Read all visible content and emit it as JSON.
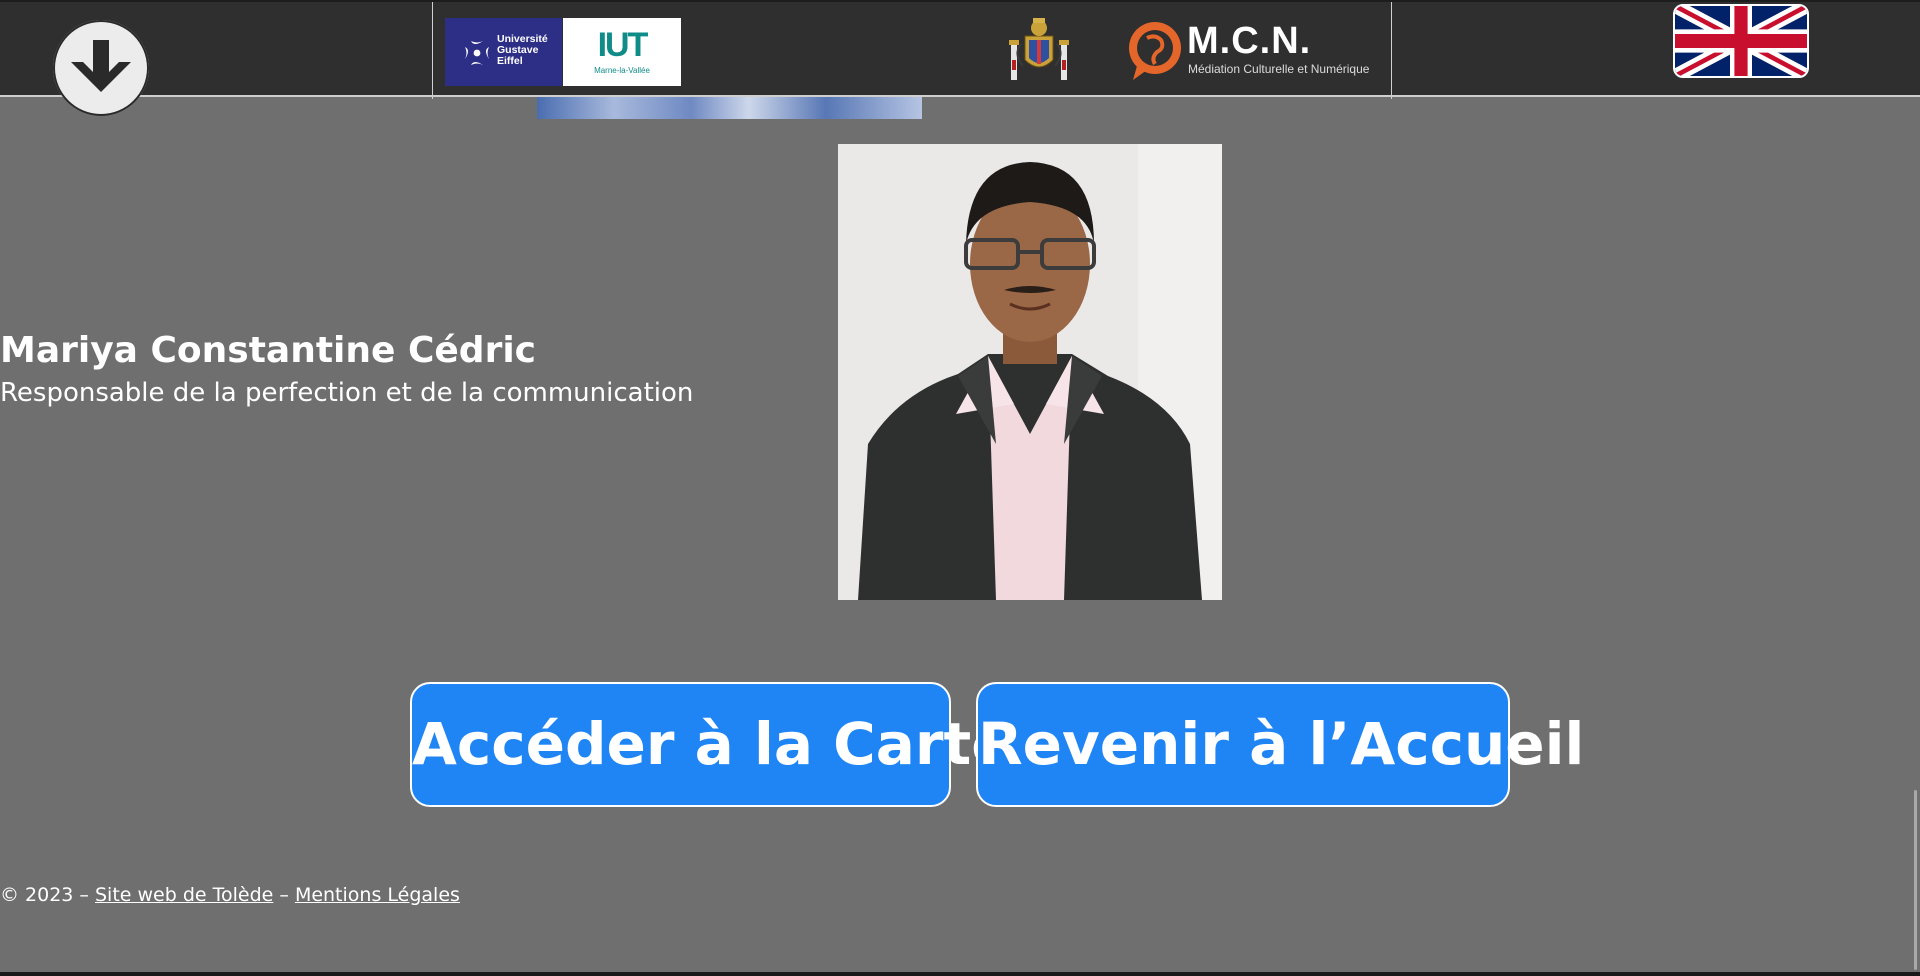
{
  "header": {
    "scroll_button_icon": "arrow-down-icon",
    "uge_logo": {
      "line1": "Université",
      "line2": "Gustave",
      "line3": "Eiffel"
    },
    "iut_logo": {
      "name": "IUT",
      "location": "Marne-la-Vallée"
    },
    "coat_of_arms_icon": "toledo-coat-of-arms-icon",
    "mcn_logo": {
      "title": "M.C.N.",
      "subtitle": "Médiation Culturelle et Numérique"
    },
    "language_flag_icon": "uk-flag-icon"
  },
  "profile": {
    "name": "Mariya Constantine Cédric",
    "role": "Responsable de la perfection et de la communication"
  },
  "buttons": {
    "map": "Accéder à la Carte",
    "home": "Revenir à l’Accueil"
  },
  "footer": {
    "copyright": "© 2023 – ",
    "site_link": "Site web de Tolède",
    "separator": " – ",
    "legal_link": "Mentions Légales"
  },
  "colors": {
    "header_bg": "#2f2f2f",
    "page_bg": "#6f6f6f",
    "button_bg": "#1f85f5",
    "uge_blue": "#2d2f86",
    "iut_teal": "#0f8b88",
    "mcn_orange": "#e4662a"
  }
}
